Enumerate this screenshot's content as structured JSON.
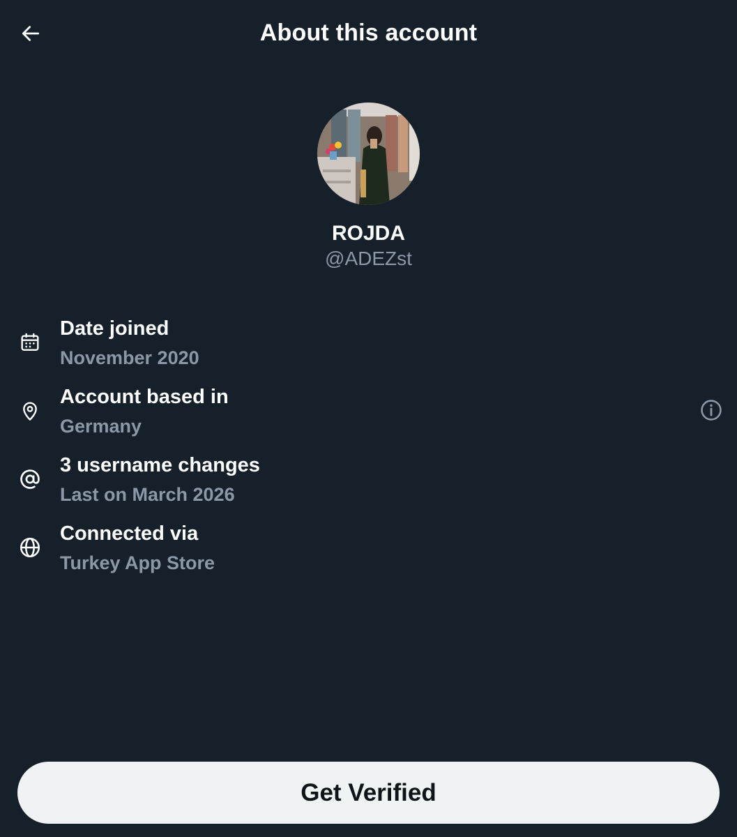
{
  "header": {
    "title": "About this account",
    "back_icon": "arrow-left-icon"
  },
  "profile": {
    "display_name": "ROJDA",
    "handle": "@ADEZst",
    "avatar": "profile-photo"
  },
  "details": [
    {
      "icon": "calendar-icon",
      "title": "Date joined",
      "value": "November 2020"
    },
    {
      "icon": "location-pin-icon",
      "title": "Account based in",
      "value": "Germany",
      "trailing_icon": "info-icon"
    },
    {
      "icon": "at-sign-icon",
      "title": "3 username changes",
      "value": "Last on March 2026"
    },
    {
      "icon": "globe-icon",
      "title": "Connected via",
      "value": "Turkey App Store"
    }
  ],
  "actions": {
    "verify_label": "Get Verified"
  },
  "colors": {
    "background": "#15202b",
    "text_primary": "#ffffff",
    "text_secondary": "#8b98a5",
    "button_bg": "#eff3f4",
    "button_text": "#0f1419"
  }
}
